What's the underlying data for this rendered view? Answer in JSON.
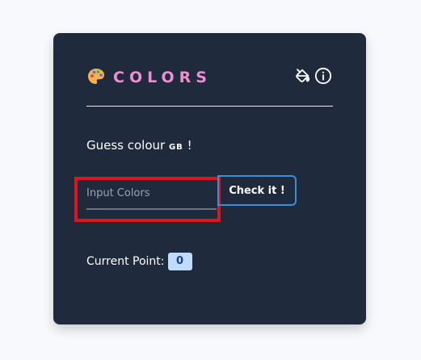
{
  "app": {
    "title": "COLORS",
    "prompt_text": "Guess colour ",
    "prompt_code": "GB",
    "prompt_suffix": " !"
  },
  "header": {
    "icons": [
      "palette-icon",
      "paint-bucket-icon",
      "info-icon"
    ]
  },
  "form": {
    "input_placeholder": "Input Colors",
    "input_value": "",
    "check_label": "Check it !"
  },
  "score": {
    "label": "Current Point:",
    "value": "0"
  },
  "colors": {
    "card_bg": "#1f2a3c",
    "title": "#ee8fd3",
    "button_border": "#3b8fd9",
    "badge_bg": "#bfdbfe",
    "badge_text": "#1e3a8a",
    "highlight": "#e0141f"
  }
}
